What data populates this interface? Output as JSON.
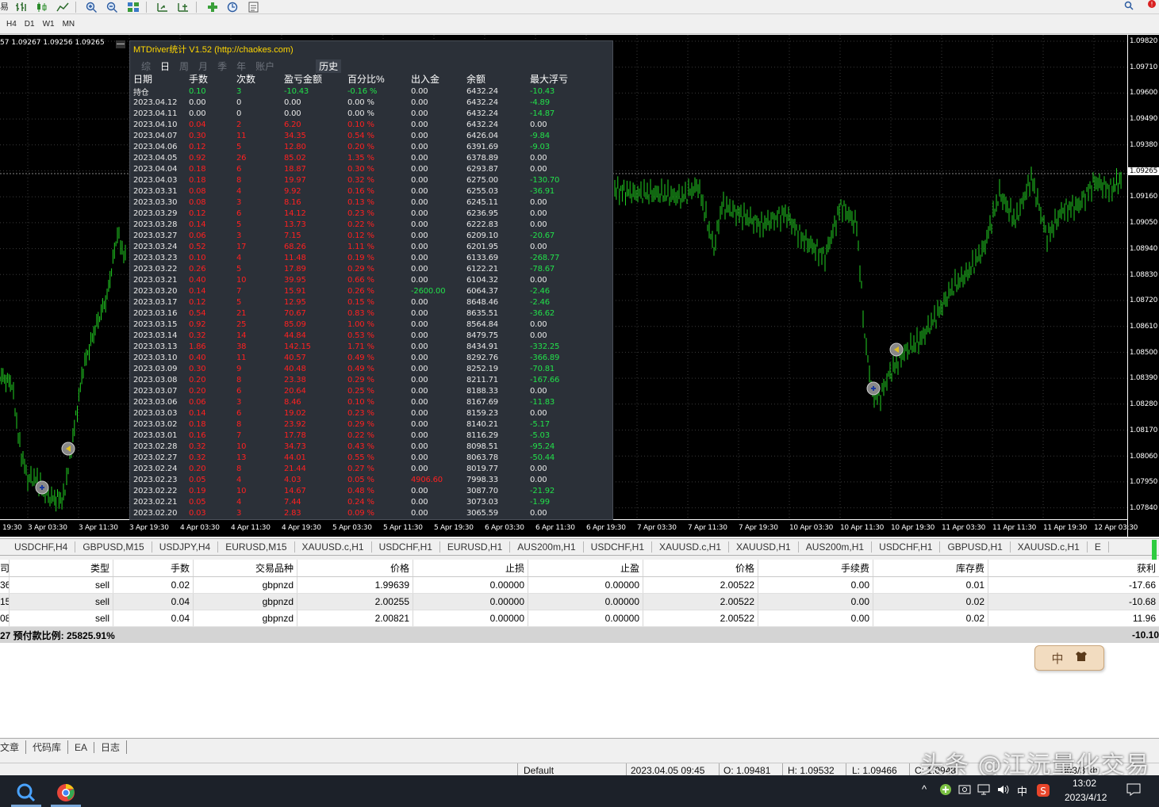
{
  "toolbar": {
    "left_fragment": "易",
    "buttons": [
      "bar-chart-icon",
      "candlestick-icon",
      "line-chart-icon",
      "zoom-in-icon",
      "zoom-out-icon",
      "tile-windows-icon",
      "autoscroll-icon",
      "chart-shift-icon",
      "indicators-icon",
      "periods-icon",
      "templates-icon"
    ]
  },
  "timeframes": [
    "H4",
    "D1",
    "W1",
    "MN"
  ],
  "chart": {
    "title": "57 1.09267 1.09256 1.09265",
    "close_label": "—",
    "current_price": "1.09265",
    "price_labels": [
      "1.09820",
      "1.09710",
      "1.09600",
      "1.09490",
      "1.09380",
      "1.09265",
      "1.09160",
      "1.09050",
      "1.08940",
      "1.08830",
      "1.08720",
      "1.08610",
      "1.08500",
      "1.08390",
      "1.08280",
      "1.08170",
      "1.08060",
      "1.07950",
      "1.07840"
    ],
    "time_labels": [
      "19:30",
      "3 Apr 03:30",
      "3 Apr 11:30",
      "3 Apr 19:30",
      "4 Apr 03:30",
      "4 Apr 11:30",
      "4 Apr 19:30",
      "5 Apr 03:30",
      "5 Apr 11:30",
      "5 Apr 19:30",
      "6 Apr 03:30",
      "6 Apr 11:30",
      "6 Apr 19:30",
      "7 Apr 03:30",
      "7 Apr 11:30",
      "7 Apr 19:30",
      "10 Apr 03:30",
      "10 Apr 11:30",
      "10 Apr 19:30",
      "11 Apr 03:30",
      "11 Apr 11:30",
      "11 Apr 19:30",
      "12 Apr 03:30"
    ],
    "colors": {
      "background": "#000000",
      "bars": "#22d022",
      "grid": "#3a3a3a"
    }
  },
  "stats": {
    "title": "MTDriver统计 V1.52  (http://chaokes.com)",
    "tabs": [
      "综",
      "日",
      "周",
      "月",
      "季",
      "年",
      "账户"
    ],
    "active_tab": "日",
    "history_tab": "历史",
    "headers": [
      "日期",
      "手数",
      "次数",
      "盈亏金额",
      "百分比%",
      "出入金",
      "余额",
      "最大浮亏"
    ],
    "holding": [
      "持仓",
      "0.10",
      "3",
      "-10.43",
      "-0.16 %",
      "0.00",
      "6432.24",
      "-10.43"
    ],
    "rows": [
      [
        "2023.04.12",
        "0.00",
        "0",
        "0.00",
        "0.00 %",
        "0.00",
        "6432.24",
        "-4.89"
      ],
      [
        "2023.04.11",
        "0.00",
        "0",
        "0.00",
        "0.00 %",
        "0.00",
        "6432.24",
        "-14.87"
      ],
      [
        "2023.04.10",
        "0.04",
        "2",
        "6.20",
        "0.10 %",
        "0.00",
        "6432.24",
        "0.00"
      ],
      [
        "2023.04.07",
        "0.30",
        "11",
        "34.35",
        "0.54 %",
        "0.00",
        "6426.04",
        "-9.84"
      ],
      [
        "2023.04.06",
        "0.12",
        "5",
        "12.80",
        "0.20 %",
        "0.00",
        "6391.69",
        "-9.03"
      ],
      [
        "2023.04.05",
        "0.92",
        "26",
        "85.02",
        "1.35 %",
        "0.00",
        "6378.89",
        "0.00"
      ],
      [
        "2023.04.04",
        "0.18",
        "6",
        "18.87",
        "0.30 %",
        "0.00",
        "6293.87",
        "0.00"
      ],
      [
        "2023.04.03",
        "0.18",
        "8",
        "19.97",
        "0.32 %",
        "0.00",
        "6275.00",
        "-130.70"
      ],
      [
        "2023.03.31",
        "0.08",
        "4",
        "9.92",
        "0.16 %",
        "0.00",
        "6255.03",
        "-36.91"
      ],
      [
        "2023.03.30",
        "0.08",
        "3",
        "8.16",
        "0.13 %",
        "0.00",
        "6245.11",
        "0.00"
      ],
      [
        "2023.03.29",
        "0.12",
        "6",
        "14.12",
        "0.23 %",
        "0.00",
        "6236.95",
        "0.00"
      ],
      [
        "2023.03.28",
        "0.14",
        "5",
        "13.73",
        "0.22 %",
        "0.00",
        "6222.83",
        "0.00"
      ],
      [
        "2023.03.27",
        "0.06",
        "3",
        "7.15",
        "0.12 %",
        "0.00",
        "6209.10",
        "-20.67"
      ],
      [
        "2023.03.24",
        "0.52",
        "17",
        "68.26",
        "1.11 %",
        "0.00",
        "6201.95",
        "0.00"
      ],
      [
        "2023.03.23",
        "0.10",
        "4",
        "11.48",
        "0.19 %",
        "0.00",
        "6133.69",
        "-268.77"
      ],
      [
        "2023.03.22",
        "0.26",
        "5",
        "17.89",
        "0.29 %",
        "0.00",
        "6122.21",
        "-78.67"
      ],
      [
        "2023.03.21",
        "0.40",
        "10",
        "39.95",
        "0.66 %",
        "0.00",
        "6104.32",
        "0.00"
      ],
      [
        "2023.03.20",
        "0.14",
        "7",
        "15.91",
        "0.26 %",
        "-2600.00",
        "6064.37",
        "-2.46"
      ],
      [
        "2023.03.17",
        "0.12",
        "5",
        "12.95",
        "0.15 %",
        "0.00",
        "8648.46",
        "-2.46"
      ],
      [
        "2023.03.16",
        "0.54",
        "21",
        "70.67",
        "0.83 %",
        "0.00",
        "8635.51",
        "-36.62"
      ],
      [
        "2023.03.15",
        "0.92",
        "25",
        "85.09",
        "1.00 %",
        "0.00",
        "8564.84",
        "0.00"
      ],
      [
        "2023.03.14",
        "0.32",
        "14",
        "44.84",
        "0.53 %",
        "0.00",
        "8479.75",
        "0.00"
      ],
      [
        "2023.03.13",
        "1.86",
        "38",
        "142.15",
        "1.71 %",
        "0.00",
        "8434.91",
        "-332.25"
      ],
      [
        "2023.03.10",
        "0.40",
        "11",
        "40.57",
        "0.49 %",
        "0.00",
        "8292.76",
        "-366.89"
      ],
      [
        "2023.03.09",
        "0.30",
        "9",
        "40.48",
        "0.49 %",
        "0.00",
        "8252.19",
        "-70.81"
      ],
      [
        "2023.03.08",
        "0.20",
        "8",
        "23.38",
        "0.29 %",
        "0.00",
        "8211.71",
        "-167.66"
      ],
      [
        "2023.03.07",
        "0.20",
        "6",
        "20.64",
        "0.25 %",
        "0.00",
        "8188.33",
        "0.00"
      ],
      [
        "2023.03.06",
        "0.06",
        "3",
        "8.46",
        "0.10 %",
        "0.00",
        "8167.69",
        "-11.83"
      ],
      [
        "2023.03.03",
        "0.14",
        "6",
        "19.02",
        "0.23 %",
        "0.00",
        "8159.23",
        "0.00"
      ],
      [
        "2023.03.02",
        "0.18",
        "8",
        "23.92",
        "0.29 %",
        "0.00",
        "8140.21",
        "-5.17"
      ],
      [
        "2023.03.01",
        "0.16",
        "7",
        "17.78",
        "0.22 %",
        "0.00",
        "8116.29",
        "-5.03"
      ],
      [
        "2023.02.28",
        "0.32",
        "10",
        "34.73",
        "0.43 %",
        "0.00",
        "8098.51",
        "-95.24"
      ],
      [
        "2023.02.27",
        "0.32",
        "13",
        "44.01",
        "0.55 %",
        "0.00",
        "8063.78",
        "-50.44"
      ],
      [
        "2023.02.24",
        "0.20",
        "8",
        "21.44",
        "0.27 %",
        "0.00",
        "8019.77",
        "0.00"
      ],
      [
        "2023.02.23",
        "0.05",
        "4",
        "4.03",
        "0.05 %",
        "4906.60",
        "7998.33",
        "0.00"
      ],
      [
        "2023.02.22",
        "0.19",
        "10",
        "14.67",
        "0.48 %",
        "0.00",
        "3087.70",
        "-21.92"
      ],
      [
        "2023.02.21",
        "0.05",
        "4",
        "7.44",
        "0.24 %",
        "0.00",
        "3073.03",
        "-1.99"
      ],
      [
        "2023.02.20",
        "0.03",
        "3",
        "2.83",
        "0.09 %",
        "0.00",
        "3065.59",
        "0.00"
      ]
    ]
  },
  "symbol_tabs": [
    "USDCHF,H4",
    "GBPUSD,M15",
    "USDJPY,H4",
    "EURUSD,M15",
    "XAUUSD.c,H1",
    "USDCHF,H1",
    "EURUSD,H1",
    "AUS200m,H1",
    "USDCHF,H1",
    "XAUUSD.c,H1",
    "XAUUSD,H1",
    "AUS200m,H1",
    "USDCHF,H1",
    "GBPUSD,H1",
    "XAUUSD.c,H1",
    "E"
  ],
  "trades": {
    "headers": [
      "司",
      "类型",
      "手数",
      "交易品种",
      "价格",
      "止损",
      "止盈",
      "价格",
      "手续费",
      "库存费",
      "获利"
    ],
    "rows": [
      [
        "36",
        "sell",
        "0.02",
        "gbpnzd",
        "1.99639",
        "0.00000",
        "0.00000",
        "2.00522",
        "0.00",
        "0.01",
        "-17.66"
      ],
      [
        "15",
        "sell",
        "0.04",
        "gbpnzd",
        "2.00255",
        "0.00000",
        "0.00000",
        "2.00522",
        "0.00",
        "0.02",
        "-10.68"
      ],
      [
        "08",
        "sell",
        "0.04",
        "gbpnzd",
        "2.00821",
        "0.00000",
        "0.00000",
        "2.00522",
        "0.00",
        "0.02",
        "11.96"
      ]
    ],
    "summary_left": "27  预付款比例: 25825.91%",
    "summary_right": "-10.10"
  },
  "ime": {
    "label": "中",
    "icon": "shirt-icon"
  },
  "bottom_tabs": [
    "文章",
    "代码库",
    "EA",
    "日志"
  ],
  "status": {
    "profile": "Default",
    "datetime": "2023.04.05 09:45",
    "open": "O: 1.09481",
    "high": "H: 1.09532",
    "low": "L: 1.09466",
    "close_fragment": "C: 1.0948",
    "conn": "803/3 kb"
  },
  "watermark": "头条 @江沅量化交易",
  "taskbar": {
    "time": "13:02",
    "date": "2023/4/12",
    "ime": "中"
  }
}
